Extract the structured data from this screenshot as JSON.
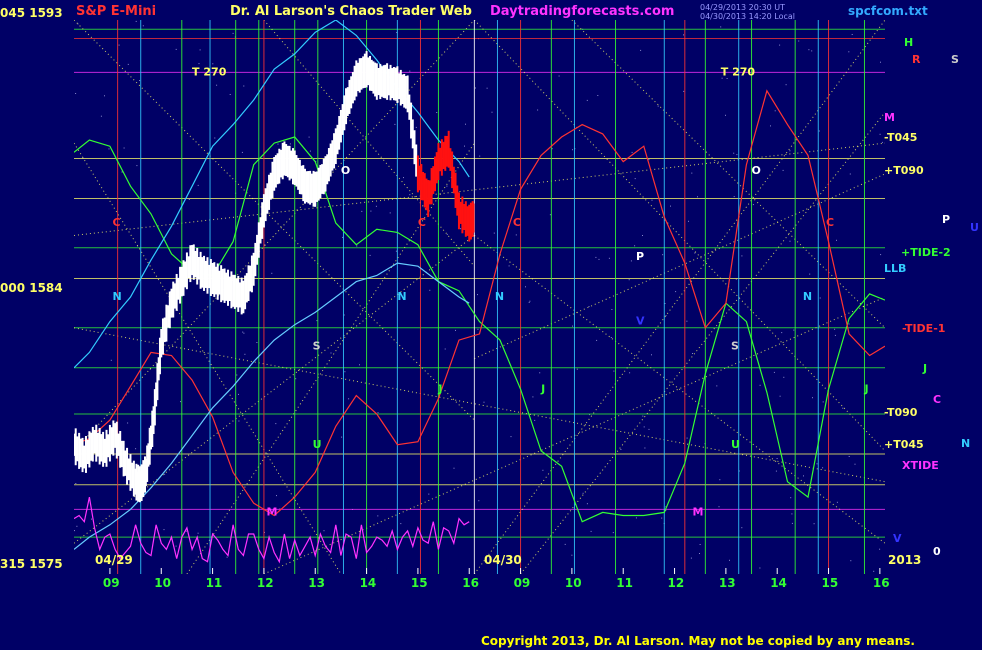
{
  "header": {
    "symbol": "S&P E-Mini",
    "title": "Dr. Al Larson's Chaos Trader Web",
    "site": "Daytradingforecasts.com",
    "file": "spcfcom.txt",
    "timestamp_line1": "04/29/2013 20:30 UT",
    "timestamp_line2": "04/30/2013 14:20 Local"
  },
  "footer": {
    "copyright": "Copyright 2013, Dr. Al Larson. May not be copied by any means.",
    "date1": "04/29",
    "date2": "04/30",
    "year": "2013",
    "zero": "0"
  },
  "y_axis": [
    {
      "label": "045  1593",
      "value": 1593
    },
    {
      "label": "000  1584",
      "value": 1584
    },
    {
      "label": "315  1575",
      "value": 1575
    }
  ],
  "x_axis": {
    "ticks": [
      "09",
      "10",
      "11",
      "12",
      "13",
      "14",
      "15",
      "16",
      "09",
      "10",
      "11",
      "12",
      "13",
      "14",
      "15",
      "16"
    ]
  },
  "right_labels": [
    {
      "text": "H",
      "color": "#33ff33"
    },
    {
      "text": "R",
      "color": "#ff3333"
    },
    {
      "text": "S",
      "color": "#cccccc"
    },
    {
      "text": "M",
      "color": "#ff33ff"
    },
    {
      "text": "-T045",
      "color": "#ffff66"
    },
    {
      "text": "+T090",
      "color": "#ffff66"
    },
    {
      "text": "P",
      "color": "#ffffff"
    },
    {
      "text": "U",
      "color": "#3333ff"
    },
    {
      "text": "+TIDE-2",
      "color": "#33ff33"
    },
    {
      "text": "LLB",
      "color": "#33ccff"
    },
    {
      "text": "-TIDE-1",
      "color": "#ff3333"
    },
    {
      "text": "J",
      "color": "#33ff33"
    },
    {
      "text": "C",
      "color": "#ff33ff"
    },
    {
      "text": "-T090",
      "color": "#ffff66"
    },
    {
      "text": "N",
      "color": "#33ccff"
    },
    {
      "text": "+T045",
      "color": "#ffff66"
    },
    {
      "text": "XTIDE",
      "color": "#ff33ff"
    },
    {
      "text": "V",
      "color": "#3333ff"
    }
  ],
  "chart_markers": [
    {
      "text": "T   270",
      "color": "#ffff66"
    },
    {
      "text": "T   270",
      "color": "#ffff66"
    },
    {
      "text": "C",
      "color": "#ff3333"
    },
    {
      "text": "C",
      "color": "#ff3333"
    },
    {
      "text": "C",
      "color": "#ff3333"
    },
    {
      "text": "C",
      "color": "#ff3333"
    },
    {
      "text": "N",
      "color": "#33ccff"
    },
    {
      "text": "N",
      "color": "#33ccff"
    },
    {
      "text": "N",
      "color": "#33ccff"
    },
    {
      "text": "N",
      "color": "#33ccff"
    },
    {
      "text": "O",
      "color": "#ffffff"
    },
    {
      "text": "O",
      "color": "#ffffff"
    },
    {
      "text": "M",
      "color": "#ff33ff"
    },
    {
      "text": "M",
      "color": "#ff33ff"
    },
    {
      "text": "U",
      "color": "#33ff33"
    },
    {
      "text": "U",
      "color": "#33ff33"
    },
    {
      "text": "J",
      "color": "#33ff33"
    },
    {
      "text": "J",
      "color": "#33ff33"
    },
    {
      "text": "J",
      "color": "#33ff33"
    },
    {
      "text": "P",
      "color": "#ffffff"
    },
    {
      "text": "S",
      "color": "#cccccc"
    },
    {
      "text": "S",
      "color": "#cccccc"
    },
    {
      "text": "V",
      "color": "#3333ff"
    }
  ],
  "chart_data": {
    "type": "line",
    "ylim": [
      1575,
      1593
    ],
    "x_range_hours": [
      8.3,
      16.1
    ],
    "price_series": {
      "name": "S&P E-Mini",
      "day": "04/29",
      "x": [
        8.3,
        8.5,
        8.7,
        8.9,
        9.1,
        9.3,
        9.5,
        9.6,
        9.7,
        9.85,
        10.0,
        10.2,
        10.4,
        10.6,
        10.8,
        11.0,
        11.2,
        11.4,
        11.6,
        11.8,
        12.0,
        12.2,
        12.4,
        12.6,
        12.8,
        13.0,
        13.2,
        13.4,
        13.6,
        13.8,
        14.0,
        14.2,
        14.4,
        14.6,
        14.8,
        15.0,
        15.2,
        15.4,
        15.6,
        15.8,
        16.0,
        16.1
      ],
      "y": [
        1579.2,
        1578.8,
        1579.3,
        1579.0,
        1579.5,
        1578.6,
        1578.0,
        1577.9,
        1578.3,
        1580.0,
        1582.5,
        1583.8,
        1584.5,
        1585.2,
        1584.8,
        1584.6,
        1584.4,
        1584.2,
        1584.0,
        1584.9,
        1586.8,
        1588.0,
        1588.5,
        1588.2,
        1587.6,
        1587.5,
        1588.0,
        1588.9,
        1590.2,
        1591.1,
        1591.4,
        1591.0,
        1591.0,
        1590.9,
        1590.6,
        1588.0,
        1587.2,
        1588.4,
        1588.8,
        1586.8,
        1586.4,
        1586.6
      ]
    },
    "series": [
      {
        "name": "Green",
        "x": [
          8.3,
          8.6,
          9.0,
          9.4,
          9.8,
          10.2,
          10.6,
          11.0,
          11.4,
          11.8,
          12.2,
          12.6,
          13.0,
          13.4,
          13.8,
          14.2,
          14.6,
          15.0,
          15.4,
          15.8,
          16.2,
          16.6,
          17.0,
          17.4,
          17.8,
          18.2,
          18.6,
          19.0,
          19.4,
          19.8,
          20.2,
          20.6,
          21.0,
          21.4,
          21.8,
          22.2,
          22.6,
          23.0,
          23.4,
          23.8,
          24.1
        ],
        "y": [
          1588.7,
          1589.1,
          1588.9,
          1587.6,
          1586.7,
          1585.4,
          1584.8,
          1584.7,
          1585.8,
          1588.3,
          1589.0,
          1589.2,
          1588.4,
          1586.4,
          1585.7,
          1586.2,
          1586.1,
          1585.7,
          1584.5,
          1584.2,
          1583.2,
          1582.6,
          1581.0,
          1579.0,
          1578.5,
          1576.7,
          1577.0,
          1576.9,
          1576.9,
          1577.0,
          1578.6,
          1581.5,
          1583.8,
          1583.2,
          1580.9,
          1578.0,
          1577.5,
          1581.0,
          1583.3,
          1584.1,
          1583.9
        ]
      },
      {
        "name": "Red",
        "x": [
          8.3,
          8.6,
          9.0,
          9.4,
          9.8,
          10.2,
          10.6,
          11.0,
          11.4,
          11.8,
          12.2,
          12.6,
          13.0,
          13.4,
          13.8,
          14.2,
          14.6,
          15.0,
          15.4,
          15.8,
          16.2,
          16.6,
          17.0,
          17.4,
          17.8,
          18.2,
          18.6,
          19.0,
          19.4,
          19.8,
          20.2,
          20.6,
          21.0,
          21.4,
          21.8,
          22.2,
          22.6,
          23.0,
          23.4,
          23.8,
          24.1
        ],
        "y": [
          1579.2,
          1579.4,
          1580.0,
          1581.1,
          1582.2,
          1582.1,
          1581.3,
          1580.1,
          1578.3,
          1577.3,
          1576.9,
          1577.5,
          1578.3,
          1579.8,
          1580.8,
          1580.2,
          1579.2,
          1579.3,
          1580.7,
          1582.6,
          1582.8,
          1585.4,
          1587.5,
          1588.6,
          1589.2,
          1589.6,
          1589.3,
          1588.4,
          1588.9,
          1586.6,
          1585.1,
          1583.0,
          1583.8,
          1588.3,
          1590.7,
          1589.6,
          1588.6,
          1585.8,
          1582.8,
          1582.1,
          1582.4
        ]
      },
      {
        "name": "Cyan",
        "x": [
          8.3,
          8.6,
          9.0,
          9.4,
          9.8,
          10.2,
          10.6,
          11.0,
          11.4,
          11.8,
          12.2,
          12.6,
          13.0,
          13.4,
          13.8,
          14.2,
          14.6,
          15.0,
          15.4,
          15.8,
          16.0
        ],
        "y": [
          1581.7,
          1582.2,
          1583.2,
          1584.0,
          1585.2,
          1586.3,
          1587.6,
          1588.9,
          1589.6,
          1590.4,
          1591.4,
          1591.9,
          1592.6,
          1593.0,
          1592.5,
          1591.7,
          1590.8,
          1590.0,
          1589.1,
          1588.4,
          1587.9
        ]
      },
      {
        "name": "Light Blue",
        "x": [
          8.3,
          8.6,
          9.0,
          9.4,
          9.8,
          10.2,
          10.6,
          11.0,
          11.4,
          11.8,
          12.2,
          12.6,
          13.0,
          13.4,
          13.8,
          14.2,
          14.6,
          15.0,
          15.4,
          15.8,
          16.0
        ],
        "y": [
          1575.8,
          1576.2,
          1576.6,
          1577.1,
          1577.8,
          1578.6,
          1579.5,
          1580.4,
          1581.1,
          1581.9,
          1582.6,
          1583.1,
          1583.5,
          1584.0,
          1584.5,
          1584.7,
          1585.1,
          1585.0,
          1584.5,
          1584.0,
          1583.8
        ]
      },
      {
        "name": "Magenta",
        "x": [
          8.3,
          8.4,
          8.5,
          8.6,
          8.7,
          8.8,
          8.9,
          9.0,
          9.1,
          9.2,
          9.3,
          9.4,
          9.5,
          9.6,
          9.7,
          9.8,
          9.9,
          10.0,
          10.1,
          10.2,
          10.3,
          10.4,
          10.5,
          10.6,
          10.7,
          10.8,
          10.9,
          11.0,
          11.1,
          11.2,
          11.3,
          11.4,
          11.5,
          11.6,
          11.7,
          11.8,
          11.9,
          12.0,
          12.1,
          12.2,
          12.3,
          12.4,
          12.5,
          12.6,
          12.7,
          12.8,
          12.9,
          13.0,
          13.1,
          13.2,
          13.3,
          13.4,
          13.5,
          13.6,
          13.7,
          13.8,
          13.9,
          14.0,
          14.1,
          14.2,
          14.3,
          14.4,
          14.5,
          14.6,
          14.7,
          14.8,
          14.9,
          15.0,
          15.1,
          15.2,
          15.3,
          15.4,
          15.5,
          15.6,
          15.7,
          15.8,
          15.9,
          16.0
        ],
        "y": [
          1576.8,
          1576.9,
          1576.7,
          1577.5,
          1576.5,
          1575.8,
          1576.2,
          1576.3,
          1575.8,
          1575.5,
          1575.7,
          1575.9,
          1576.6,
          1576.0,
          1575.7,
          1575.6,
          1576.6,
          1576.0,
          1575.8,
          1576.2,
          1575.5,
          1576.2,
          1576.5,
          1575.8,
          1576.2,
          1575.5,
          1575.4,
          1576.3,
          1576.1,
          1575.8,
          1575.6,
          1576.6,
          1575.8,
          1575.6,
          1576.3,
          1576.3,
          1575.8,
          1575.5,
          1576.2,
          1575.7,
          1575.4,
          1576.3,
          1575.5,
          1576.1,
          1575.6,
          1575.9,
          1576.2,
          1575.6,
          1576.3,
          1575.9,
          1575.7,
          1576.6,
          1575.6,
          1576.3,
          1576.2,
          1575.5,
          1576.6,
          1575.7,
          1575.9,
          1576.2,
          1576.1,
          1575.9,
          1576.4,
          1575.8,
          1576.2,
          1576.4,
          1575.9,
          1576.5,
          1576.1,
          1576.0,
          1576.7,
          1575.8,
          1576.5,
          1576.4,
          1576.0,
          1576.8,
          1576.6,
          1576.7
        ]
      }
    ]
  }
}
